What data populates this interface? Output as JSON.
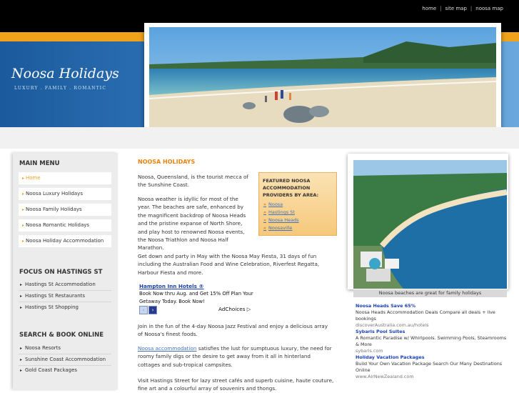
{
  "topnav": {
    "home": "home",
    "sitemap": "site map",
    "noosamap": "noosa map"
  },
  "site": {
    "title": "Noosa Holidays",
    "tagline": "LUXURY . FAMILY . ROMANTIC"
  },
  "sidebar": {
    "main_menu_heading": "MAIN MENU",
    "main_menu": [
      {
        "label": "Home"
      },
      {
        "label": "Noosa Luxury Holidays"
      },
      {
        "label": "Noosa Family Holidays"
      },
      {
        "label": "Noosa Romantic Holidays"
      },
      {
        "label": "Noosa Holiday Accommodation"
      }
    ],
    "focus_heading": "FOCUS ON HASTINGS ST",
    "focus_links": [
      {
        "label": "Hastings St Accommodation"
      },
      {
        "label": "Hastings St Restaurants"
      },
      {
        "label": "Hastings St Shopping"
      }
    ],
    "search_heading": "SEARCH & BOOK ONLINE",
    "search_links": [
      {
        "label": "Noosa Resorts"
      },
      {
        "label": "Sunshine Coast Accommodation"
      },
      {
        "label": "Gold Coast Packages"
      }
    ]
  },
  "main": {
    "title": "NOOSA HOLIDAYS",
    "p1": "Noosa, Queensland, is the tourist mecca of the Sunshine Coast.",
    "p2": "Noosa weather is idyllic for most of the year. The beaches are safe, enhanced by the magnificent backdrop of Noosa Heads and the pristine expanse of North Shore, and play host to renowned Noosa events, the Noosa Triathlon and Noosa Half Marathon.",
    "p3": "Get down and party in May with the Noosa May Fiesta, 31 days of fun including the Australian Food and Wine Celebration, Riverfest Regatta, Harbour Fiesta and more.",
    "p4": "Join in the fun of the 4-day Noosa Jazz Festival and enjoy a delicious array of Noosa's finest foods.",
    "p5_link": "Noosa accommodation",
    "p5_rest": " satisfies the lust for sumptuous luxury, the need for roomy family digs or the desire to get away from it all in hinterland cottages and sub-tropical campsites.",
    "p6": "Visit Hastings Street for lazy street cafés and superb cuisine, haute couture, fine art and a colourful array of souvenirs and thongs."
  },
  "featured": {
    "heading": "FEATURED NOOSA ACCOMMODATION PROVIDERS BY AREA:",
    "links": [
      {
        "label": "Noosa"
      },
      {
        "label": "Hastings St"
      },
      {
        "label": "Noosa Heads"
      },
      {
        "label": "Noosaville"
      }
    ]
  },
  "ad1": {
    "title": "Hampton Inn Hotels ®",
    "body": "Book Now thru Aug. and Get 15% Off Plan Your Getaway Today. Book Now!",
    "adchoices": "AdChoices ▷",
    "prev": "‹",
    "next": "›"
  },
  "side": {
    "caption": "Noosa beaches are great for family holidays",
    "ads": [
      {
        "title": "Noosa Heads Save 65%",
        "body": "Noosa Heads Accommodation Deals Compare all deals + live bookings",
        "url": "discoverAustralia.com.au/hotels"
      },
      {
        "title": "Sybaris Pool Suites",
        "body": "A Romantic Paradise w/ Whirlpools. Swimming Pools, Steamrooms & More",
        "url": "sybaris.com"
      },
      {
        "title": "Holiday Vacation Packages",
        "body": "Build Your Own Vacation Package Search Our Many Destinations Online",
        "url": "www.AirNewZealand.com"
      }
    ]
  }
}
